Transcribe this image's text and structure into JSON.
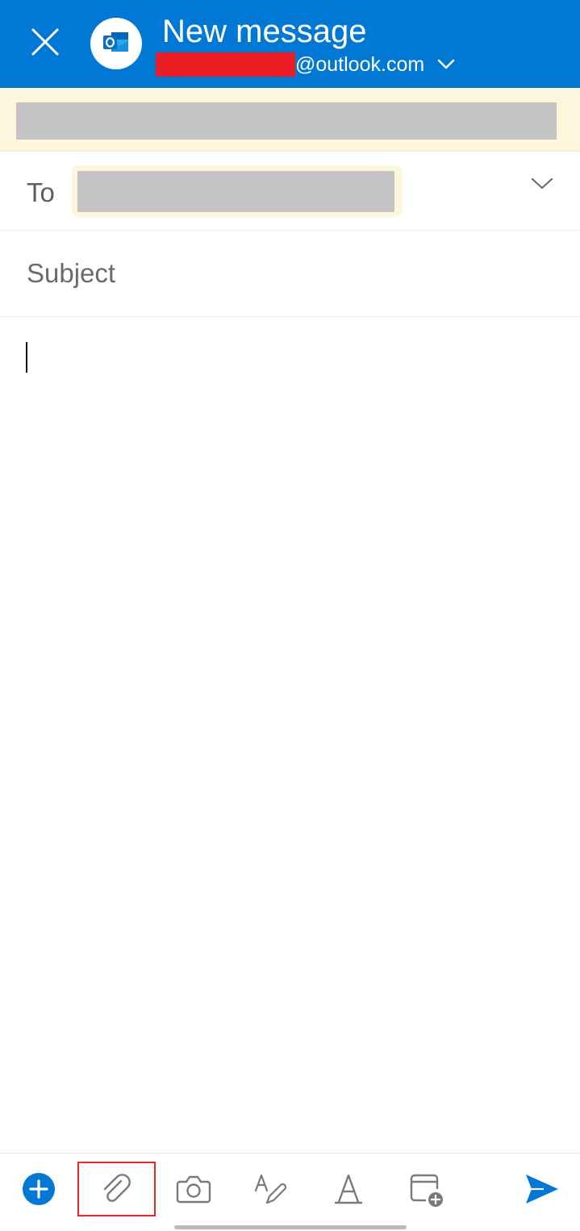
{
  "header": {
    "title": "New message",
    "account_domain": "@outlook.com",
    "background_color": "#0078d4",
    "close_icon": "close-icon",
    "app_icon": "outlook-logo-icon"
  },
  "compose": {
    "to_label": "To",
    "subject_placeholder": "Subject",
    "body_value": ""
  },
  "toolbar": {
    "items": [
      {
        "name": "add-button",
        "icon": "plus-circle-icon"
      },
      {
        "name": "attach-button",
        "icon": "paperclip-icon",
        "highlighted": true
      },
      {
        "name": "camera-button",
        "icon": "camera-icon"
      },
      {
        "name": "draw-button",
        "icon": "pen-draw-icon"
      },
      {
        "name": "format-button",
        "icon": "text-format-icon"
      },
      {
        "name": "schedule-button",
        "icon": "calendar-add-icon"
      },
      {
        "name": "send-button",
        "icon": "send-icon"
      }
    ]
  },
  "colors": {
    "accent": "#0078d4",
    "warning_banner": "#fdf6dd",
    "highlight": "#e8262a"
  }
}
